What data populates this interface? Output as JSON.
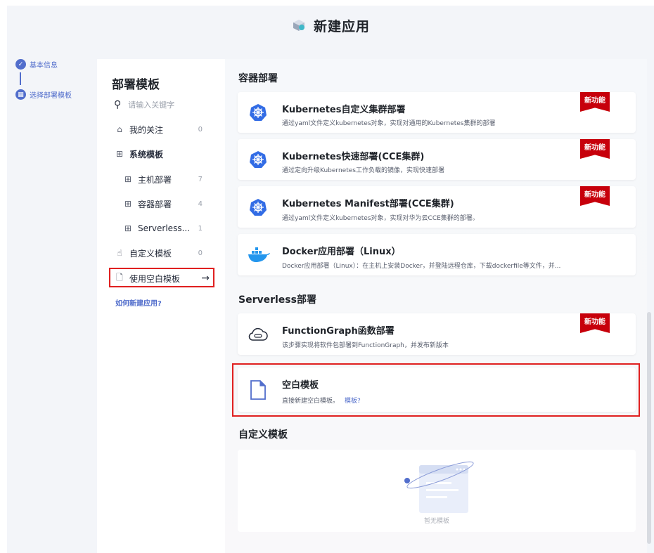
{
  "header": {
    "title": "新建应用",
    "icon": "app-cube-icon"
  },
  "steps": [
    {
      "label": "基本信息",
      "icon": "check-icon"
    },
    {
      "label": "选择部署模板",
      "icon": "template-step-icon"
    }
  ],
  "sidebar": {
    "title": "部署模板",
    "search_placeholder": "请输入关键字",
    "items": [
      {
        "label": "我的关注",
        "count": "0",
        "icon": "home-icon"
      },
      {
        "label": "系统模板",
        "icon": "grid-icon"
      },
      {
        "label": "主机部署",
        "count": "7",
        "icon": "grid-icon"
      },
      {
        "label": "容器部署",
        "count": "4",
        "icon": "grid-icon"
      },
      {
        "label": "Serverless...",
        "count": "1",
        "icon": "grid-icon"
      },
      {
        "label": "自定义模板",
        "count": "0",
        "icon": "hand-icon"
      },
      {
        "label": "使用空白模板",
        "icon": "file-icon",
        "arrow": "→"
      }
    ],
    "help_link": "如何新建应用?"
  },
  "sections": {
    "container": "容器部署",
    "serverless": "Serverless部署",
    "custom": "自定义模板"
  },
  "cards": [
    {
      "title": "Kubernetes自定义集群部署",
      "desc": "通过yaml文件定义kubernetes对象，实现对通用的Kubernetes集群的部署",
      "badge": "新功能",
      "icon": "kubernetes-icon"
    },
    {
      "title": "Kubernetes快速部署(CCE集群)",
      "desc": "通过定向升级Kubernetes工作负载的镜像，实现快速部署",
      "badge": "新功能",
      "icon": "kubernetes-icon"
    },
    {
      "title": "Kubernetes Manifest部署(CCE集群)",
      "desc": "通过yaml文件定义kubernetes对象，实现对华为云CCE集群的部署。",
      "badge": "新功能",
      "icon": "kubernetes-icon"
    },
    {
      "title": "Docker应用部署（Linux）",
      "desc": "Docker应用部署（Linux）：在主机上安装Docker，并登陆远程仓库，下载dockerfile等文件，并...",
      "icon": "docker-icon"
    },
    {
      "title": "FunctionGraph函数部署",
      "desc": "该步骤实现将软件包部署到FunctionGraph，并发布新版本",
      "badge": "新功能",
      "icon": "cloud-function-icon"
    },
    {
      "title": "空白模板",
      "desc": "直接新建空白模板。",
      "link": "模板?",
      "icon": "blank-file-icon"
    }
  ],
  "empty": {
    "text": "暂无模板",
    "icon": "empty-illustration-icon"
  },
  "colors": {
    "brand": "#526ecc",
    "badge": "#c7000b",
    "highlight": "#e02020",
    "k8s": "#326ce5"
  }
}
